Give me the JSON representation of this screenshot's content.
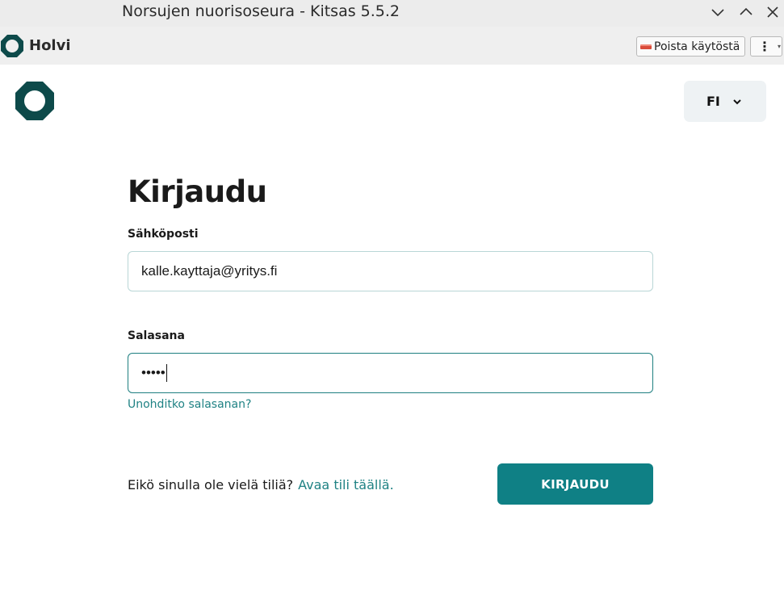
{
  "window": {
    "title": "Norsujen nuorisoseura - Kitsas 5.5.2"
  },
  "toolbar": {
    "app_name": "Holvi",
    "disable_label": "Poista käytöstä"
  },
  "page": {
    "language": "FI",
    "heading": "Kirjaudu",
    "email_label": "Sähköposti",
    "email_value": "kalle.kayttaja@yritys.fi",
    "password_label": "Salasana",
    "password_value": "•••••",
    "forgot_link": "Unohditko salasanan?",
    "signup_text": "Eikö sinulla ole vielä tiliä?",
    "signup_link": "Avaa tili täällä.",
    "login_button": "KIRJAUDU"
  },
  "colors": {
    "brand_dark": "#0d4a4a",
    "accent": "#0f8085",
    "link": "#1f8284"
  },
  "icons": {
    "minimize": "chevron-down-icon",
    "maximize": "chevron-up-icon",
    "close": "close-icon",
    "logo": "holvi-logo-icon",
    "menu": "kebab-menu-icon"
  }
}
